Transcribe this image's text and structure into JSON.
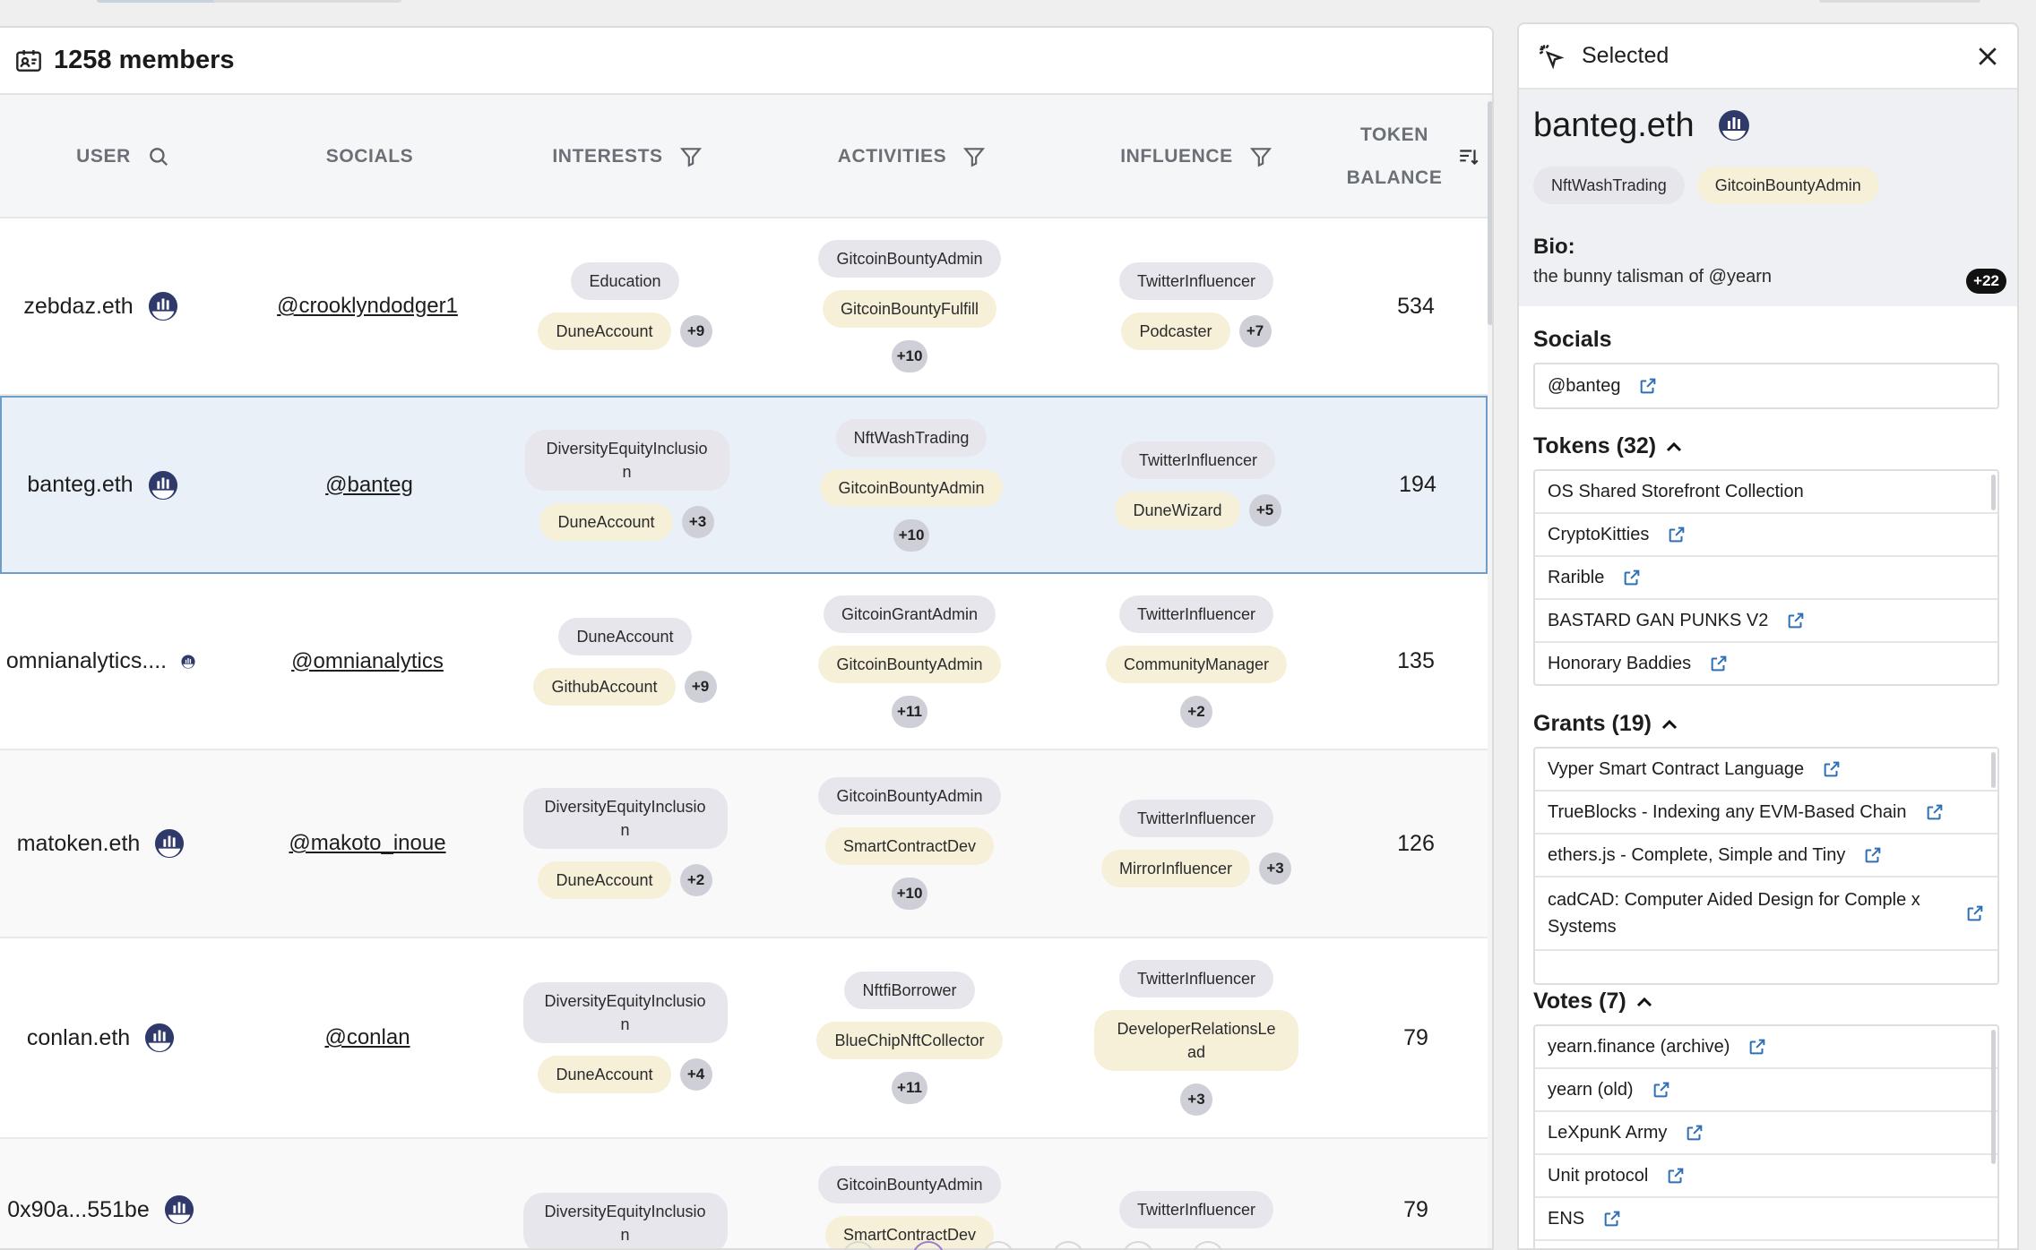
{
  "members_header": {
    "title": "1258 members",
    "icon": "contact-card-icon"
  },
  "columns": {
    "user": "USER",
    "socials": "SOCIALS",
    "interests": "INTERESTS",
    "activities": "ACTIVITIES",
    "influence": "INFLUENCE",
    "token_line1": "TOKEN",
    "token_line2": "BALANCE"
  },
  "rows": [
    {
      "user": "zebdaz.eth",
      "social": "@crooklyndodger1",
      "interests": [
        "Education",
        "DuneAccount"
      ],
      "interests_more": "+9",
      "activities": [
        "GitcoinBountyAdmin",
        "GitcoinBountyFulfill"
      ],
      "activities_more": "+10",
      "influence": [
        "TwitterInfluencer",
        "Podcaster"
      ],
      "influence_more": "+7",
      "balance": "534"
    },
    {
      "user": "banteg.eth",
      "social": "@banteg",
      "interests": [
        "DiversityEquityInclusio\nn",
        "DuneAccount"
      ],
      "interests_more": "+3",
      "activities": [
        "NftWashTrading",
        "GitcoinBountyAdmin"
      ],
      "activities_more": "+10",
      "influence": [
        "TwitterInfluencer",
        "DuneWizard"
      ],
      "influence_more": "+5",
      "balance": "194"
    },
    {
      "user": "omnianalytics....",
      "social": "@omnianalytics",
      "interests": [
        "DuneAccount",
        "GithubAccount"
      ],
      "interests_more": "+9",
      "activities": [
        "GitcoinGrantAdmin",
        "GitcoinBountyAdmin"
      ],
      "activities_more": "+11",
      "influence": [
        "TwitterInfluencer",
        "CommunityManager"
      ],
      "influence_more": "+2",
      "balance": "135"
    },
    {
      "user": "matoken.eth",
      "social": "@makoto_inoue",
      "interests": [
        "DiversityEquityInclusio\nn",
        "DuneAccount"
      ],
      "interests_more": "+2",
      "activities": [
        "GitcoinBountyAdmin",
        "SmartContractDev"
      ],
      "activities_more": "+10",
      "influence": [
        "TwitterInfluencer",
        "MirrorInfluencer"
      ],
      "influence_more": "+3",
      "balance": "126"
    },
    {
      "user": "conlan.eth",
      "social": "@conlan",
      "interests": [
        "DiversityEquityInclusio\nn",
        "DuneAccount"
      ],
      "interests_more": "+4",
      "activities": [
        "NftfiBorrower",
        "BlueChipNftCollector"
      ],
      "activities_more": "+11",
      "influence": [
        "TwitterInfluencer",
        "DeveloperRelationsLe\nad"
      ],
      "influence_more": "+3",
      "balance": "79"
    },
    {
      "user": "0x90a...551be",
      "social": "",
      "interests": [
        "DiversityEquityInclusio\nn"
      ],
      "activities": [
        "GitcoinBountyAdmin",
        "SmartContractDev"
      ],
      "influence": [
        "TwitterInfluencer"
      ],
      "balance": "79"
    }
  ],
  "side": {
    "title": "Selected",
    "name": "banteg.eth",
    "tags": [
      "NftWashTrading",
      "GitcoinBountyAdmin"
    ],
    "tags_more": "+22",
    "bio_label": "Bio:",
    "bio": "the bunny talisman of @yearn",
    "socials_title": "Socials",
    "socials": [
      "@banteg"
    ],
    "tokens_title": "Tokens (32)",
    "tokens": [
      "OS Shared Storefront Collection",
      "CryptoKitties",
      "Rarible",
      "BASTARD GAN PUNKS V2",
      "Honorary Baddies"
    ],
    "grants_title": "Grants (19)",
    "grants": [
      "Vyper Smart Contract Language",
      "TrueBlocks - Indexing any EVM-Based Chain",
      "ethers.js - Complete, Simple and Tiny",
      "cadCAD: Computer Aided Design for Comple x Systems"
    ],
    "votes_title": "Votes (7)",
    "votes": [
      "yearn.finance (archive)",
      "yearn (old)",
      "LeXpunK Army",
      "Unit protocol",
      "ENS"
    ]
  },
  "colors": {
    "selected_row": "#e9f0f7",
    "selected_border": "#6e9ec6",
    "tag_gray": "#e7e6ec",
    "tag_cream": "#f6f0d9",
    "link_icon": "#2f6fb5"
  }
}
